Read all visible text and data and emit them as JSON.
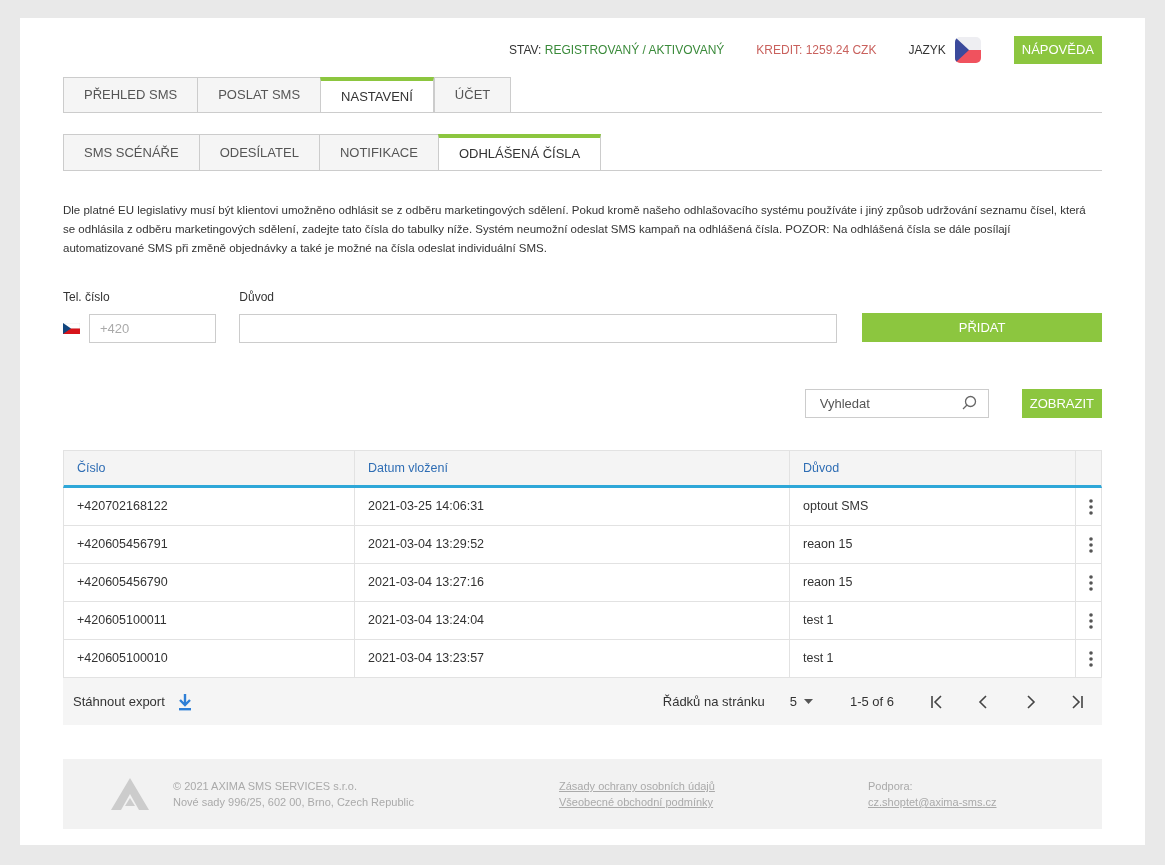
{
  "header": {
    "status_label": "STAV:",
    "status_value": "REGISTROVANÝ / AKTIVOVANÝ",
    "credit": "KREDIT: 1259.24 CZK",
    "language_label": "JAZYK",
    "help_button": "NÁPOVĚDA"
  },
  "main_tabs": [
    {
      "label": "PŘEHLED SMS",
      "selected": false
    },
    {
      "label": "POSLAT SMS",
      "selected": false
    },
    {
      "label": "NASTAVENÍ",
      "selected": true
    },
    {
      "label": "ÚČET",
      "selected": false
    }
  ],
  "sub_tabs": [
    {
      "label": "SMS SCÉNÁŘE",
      "selected": false
    },
    {
      "label": "ODESÍLATEL",
      "selected": false
    },
    {
      "label": "NOTIFIKACE",
      "selected": false
    },
    {
      "label": "ODHLÁŠENÁ ČÍSLA",
      "selected": true
    }
  ],
  "description": "Dle platné EU legislativy musí být klientovi umožněno odhlásit se z odběru marketingových sdělení. Pokud kromě našeho odhlašovacího systému používáte i jiný způsob udržování seznamu čísel, která se odhlásila z odběru marketingových sdělení, zadejte tato čísla do tabulky níže. Systém neumožní odeslat SMS kampaň na odhlášená čísla. POZOR: Na odhlášená čísla se dále posílají automatizované SMS při změně objednávky a také je možné na čísla odeslat individuální SMS.",
  "form": {
    "phone_label": "Tel. číslo",
    "phone_placeholder": "+420",
    "reason_label": "Důvod",
    "add_button": "PŘIDAT"
  },
  "search": {
    "placeholder": "Vyhledat",
    "button": "ZOBRAZIT"
  },
  "table": {
    "columns": [
      "Číslo",
      "Datum vložení",
      "Důvod"
    ],
    "rows": [
      [
        "+420702168122",
        "2021-03-25 14:06:31",
        "optout SMS"
      ],
      [
        "+420605456791",
        "2021-03-04 13:29:52",
        "reaon 15"
      ],
      [
        "+420605456790",
        "2021-03-04 13:27:16",
        "reaon 15"
      ],
      [
        "+420605100011",
        "2021-03-04 13:24:04",
        "test 1"
      ],
      [
        "+420605100010",
        "2021-03-04 13:23:57",
        "test 1"
      ]
    ],
    "export": "Stáhnout export",
    "rows_per_page_label": "Řádků na stránku",
    "rows_per_page": "5",
    "range": "1-5 of 6"
  },
  "footer": {
    "company": "© 2021 AXIMA SMS SERVICES s.r.o.",
    "address": "Nové sady 996/25, 602 00, Brno, Czech Republic",
    "links": [
      "Zásady ochrany osobních údajů",
      "Všeobecné obchodní podmínky"
    ],
    "support_label": "Podpora:",
    "support_email": "cz.shoptet@axima-sms.cz"
  }
}
